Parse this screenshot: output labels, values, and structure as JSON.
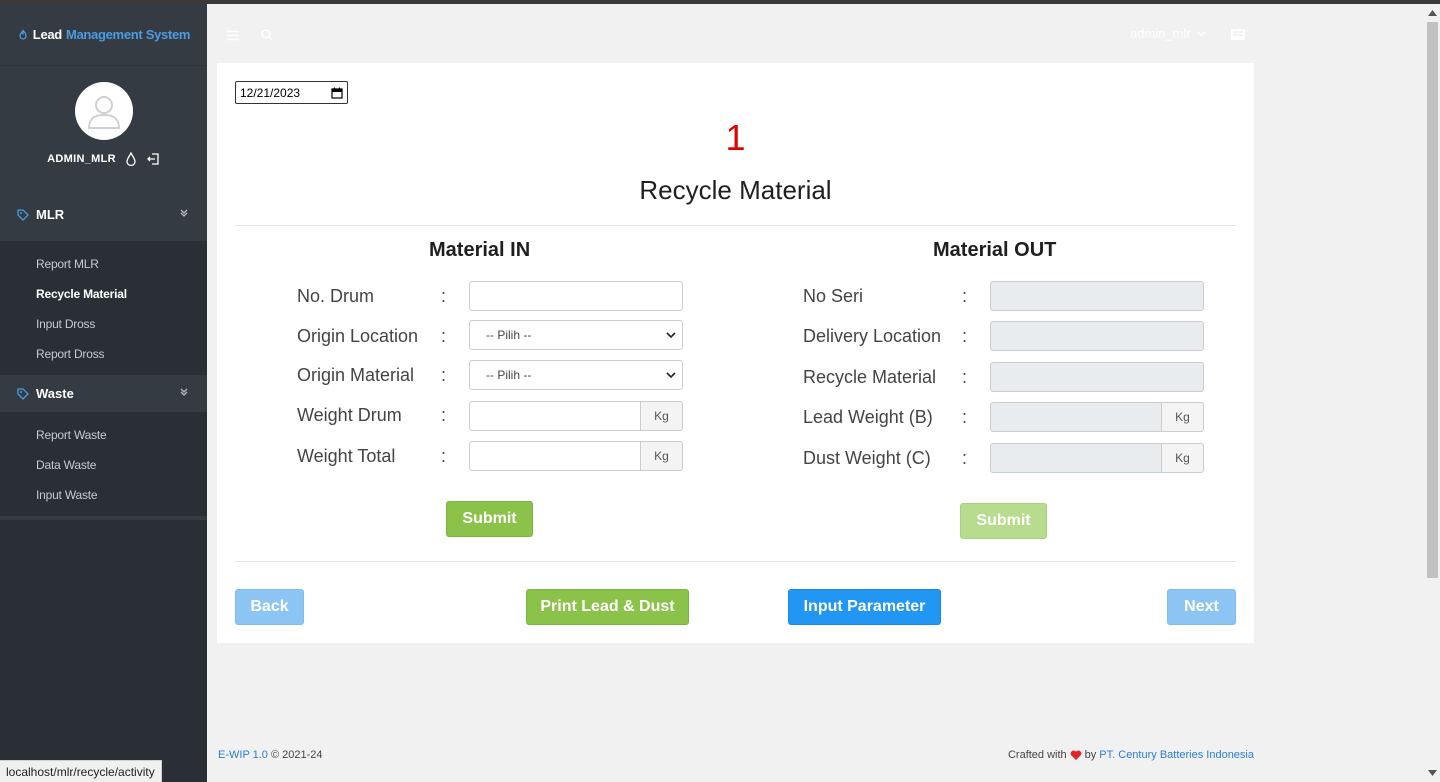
{
  "brand": {
    "part1": "Lead",
    "part2": "Management System"
  },
  "profile": {
    "username": "ADMIN_MLR"
  },
  "sidebar": {
    "groups": [
      {
        "label": "MLR",
        "items": [
          "Report MLR",
          "Recycle Material",
          "Input Dross",
          "Report Dross"
        ],
        "active": "Recycle Material"
      },
      {
        "label": "Waste",
        "items": [
          "Report Waste",
          "Data Waste",
          "Input Waste"
        ]
      }
    ]
  },
  "header": {
    "user": "admin_mlr"
  },
  "main": {
    "date": "12/21/2023",
    "counter": "1",
    "title": "Recycle Material",
    "material_in": {
      "title": "Material IN",
      "fields": [
        {
          "label": "No. Drum",
          "value": ""
        },
        {
          "label": "Origin Location",
          "value": "-- Pilih --"
        },
        {
          "label": "Origin Material",
          "value": "-- Pilih --"
        },
        {
          "label": "Weight Drum",
          "unit": "Kg"
        },
        {
          "label": "Weight Total",
          "unit": "Kg"
        }
      ],
      "submit": "Submit"
    },
    "material_out": {
      "title": "Material OUT",
      "fields": [
        {
          "label": "No Seri"
        },
        {
          "label": "Delivery Location"
        },
        {
          "label": "Recycle Material"
        },
        {
          "label": "Lead Weight (B)",
          "unit": "Kg"
        },
        {
          "label": "Dust Weight (C)",
          "unit": "Kg"
        }
      ],
      "submit": "Submit"
    },
    "colon": ":",
    "actions": {
      "back": "Back",
      "print": "Print Lead & Dust",
      "input_parameter": "Input Parameter",
      "next": "Next"
    }
  },
  "footer": {
    "app": "E-WIP 1.0",
    "copyright": "© 2021-24",
    "crafted": "Crafted with",
    "by": "by",
    "company": "PT. Century Batteries Indonesia"
  },
  "status_url": "localhost/mlr/recycle/activity",
  "colors": {
    "sidebar": "#2a2f35",
    "green": "#8bc34a",
    "blue": "#2196f3",
    "counter": "#e00000",
    "link": "#2a7fd4"
  }
}
